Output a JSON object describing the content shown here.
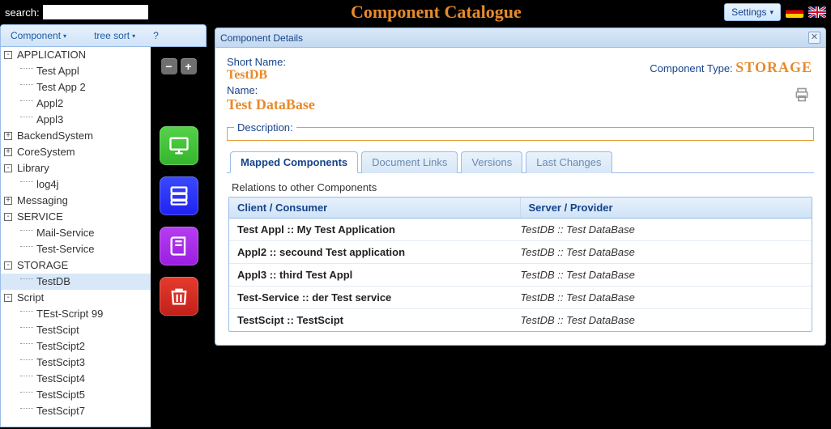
{
  "header": {
    "search_label": "search:",
    "search_value": "",
    "title": "Component Catalogue",
    "settings_label": "Settings"
  },
  "toolbar": {
    "component": "Component",
    "tree_sort": "tree sort",
    "help": "?"
  },
  "tree": [
    {
      "label": "APPLICATION",
      "expanded": true,
      "children": [
        {
          "label": "Test Appl"
        },
        {
          "label": "Test App 2"
        },
        {
          "label": "Appl2"
        },
        {
          "label": "Appl3"
        }
      ]
    },
    {
      "label": "BackendSystem",
      "expanded": false
    },
    {
      "label": "CoreSystem",
      "expanded": false
    },
    {
      "label": "Library",
      "expanded": true,
      "children": [
        {
          "label": "log4j"
        }
      ]
    },
    {
      "label": "Messaging",
      "expanded": false
    },
    {
      "label": "SERVICE",
      "expanded": true,
      "children": [
        {
          "label": "Mail-Service"
        },
        {
          "label": "Test-Service"
        }
      ]
    },
    {
      "label": "STORAGE",
      "expanded": true,
      "children": [
        {
          "label": "TestDB",
          "selected": true
        }
      ]
    },
    {
      "label": "Script",
      "expanded": true,
      "children": [
        {
          "label": "TEst-Script 99"
        },
        {
          "label": "TestScipt"
        },
        {
          "label": "TestScipt2"
        },
        {
          "label": "TestScipt3"
        },
        {
          "label": "TestScipt4"
        },
        {
          "label": "TestScipt5"
        },
        {
          "label": "TestScipt7"
        }
      ]
    }
  ],
  "sidebar_icons": {
    "collapse": "−",
    "expand": "+",
    "monitor": "monitor-icon",
    "server": "server-icon",
    "book": "book-icon",
    "trash": "trash-icon"
  },
  "details": {
    "panel_title": "Component Details",
    "short_name_label": "Short Name:",
    "short_name": "TestDB",
    "name_label": "Name:",
    "name": "Test DataBase",
    "type_label": "Component Type:",
    "type_value": "Storage",
    "description_label": "Description:",
    "tabs": {
      "mapped": "Mapped Components",
      "docs": "Document Links",
      "versions": "Versions",
      "changes": "Last Changes"
    },
    "relations_title": "Relations to other Components",
    "col_client": "Client / Consumer",
    "col_server": "Server / Provider",
    "rows": [
      {
        "client": "Test Appl :: My Test Application",
        "server": "TestDB :: Test DataBase"
      },
      {
        "client": "Appl2 :: secound Test application",
        "server": "TestDB :: Test DataBase"
      },
      {
        "client": "Appl3 :: third Test Appl",
        "server": "TestDB :: Test DataBase"
      },
      {
        "client": "Test-Service :: der Test service",
        "server": "TestDB :: Test DataBase"
      },
      {
        "client": "TestScipt :: TestScipt",
        "server": "TestDB :: Test DataBase"
      }
    ]
  }
}
